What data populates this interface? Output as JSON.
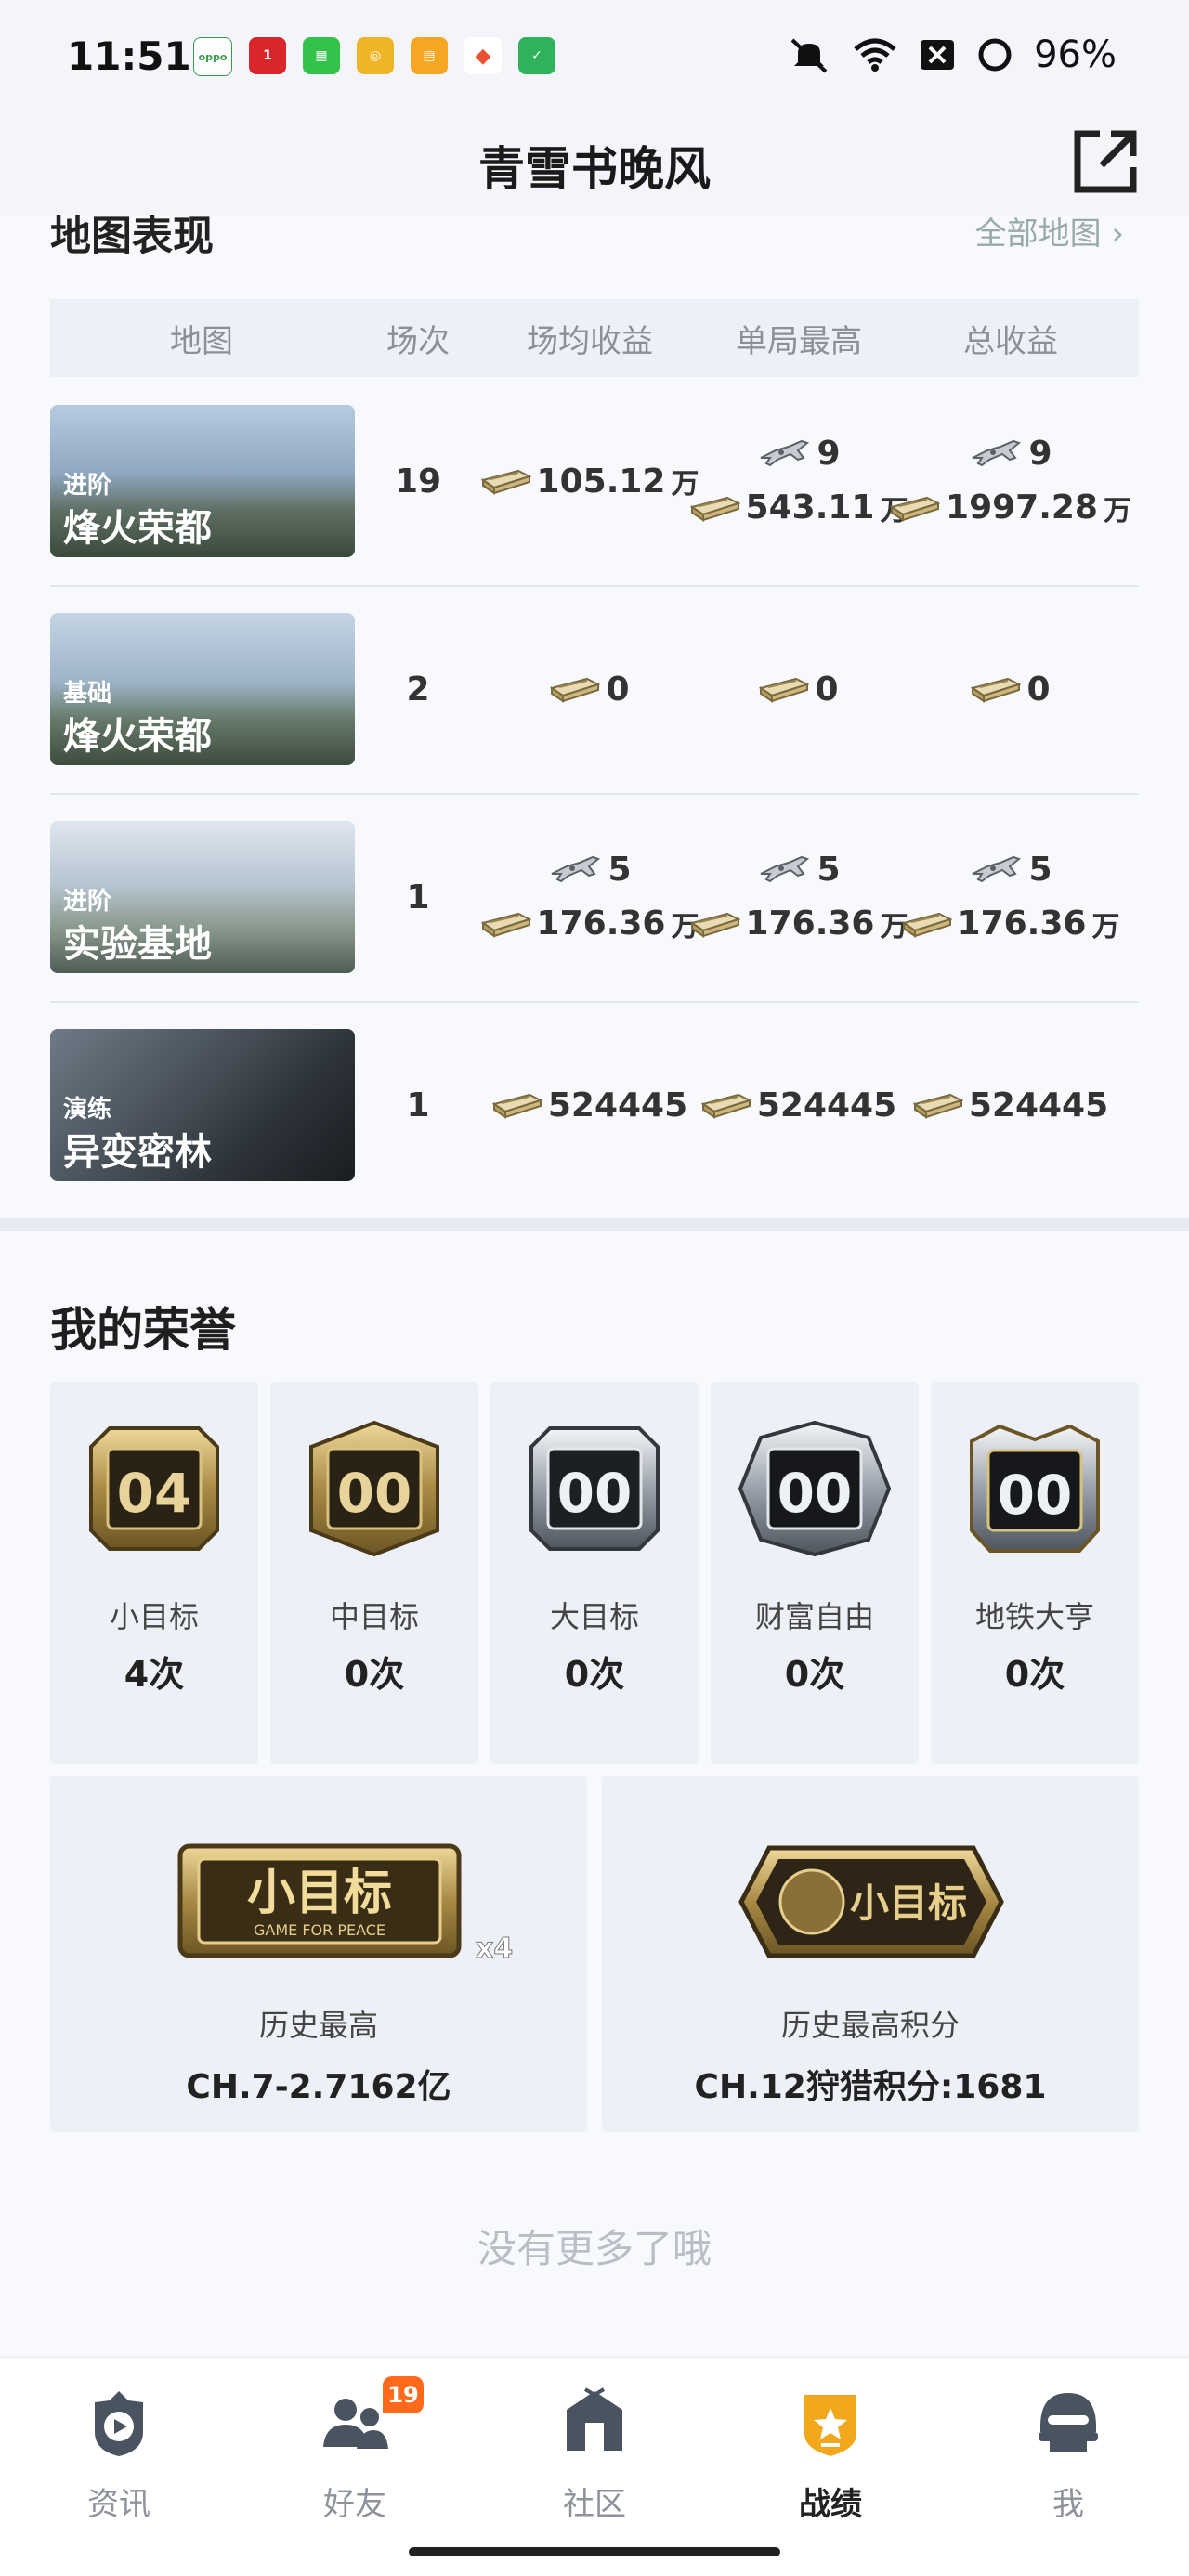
{
  "status_bar": {
    "time": "11:51",
    "battery": "96%"
  },
  "header": {
    "title": "青雪书晚风"
  },
  "maps_section": {
    "title": "地图表现",
    "all_maps": "全部地图 ›",
    "columns": [
      "地图",
      "场次",
      "场均收益",
      "单局最高",
      "总收益"
    ],
    "rows": [
      {
        "mode": "进阶",
        "name": "烽火荣都",
        "games": "19",
        "avg": {
          "cash": "105.12",
          "unit": "万"
        },
        "best": {
          "plane": "9",
          "cash": "543.11",
          "unit": "万"
        },
        "total": {
          "plane": "9",
          "cash": "1997.28",
          "unit": "万"
        }
      },
      {
        "mode": "基础",
        "name": "烽火荣都",
        "games": "2",
        "avg": {
          "cash": "0"
        },
        "best": {
          "cash": "0"
        },
        "total": {
          "cash": "0"
        }
      },
      {
        "mode": "进阶",
        "name": "实验基地",
        "games": "1",
        "avg": {
          "plane": "5",
          "cash": "176.36",
          "unit": "万"
        },
        "best": {
          "plane": "5",
          "cash": "176.36",
          "unit": "万"
        },
        "total": {
          "plane": "5",
          "cash": "176.36",
          "unit": "万"
        }
      },
      {
        "mode": "演练",
        "name": "异变密林",
        "games": "1",
        "avg": {
          "cash": "524445"
        },
        "best": {
          "cash": "524445"
        },
        "total": {
          "cash": "524445"
        }
      }
    ]
  },
  "honors": {
    "title": "我的荣誉",
    "badges": [
      {
        "number": "04",
        "label": "小目标",
        "count": "4次"
      },
      {
        "number": "00",
        "label": "中目标",
        "count": "0次"
      },
      {
        "number": "00",
        "label": "大目标",
        "count": "0次"
      },
      {
        "number": "00",
        "label": "财富自由",
        "count": "0次"
      },
      {
        "number": "00",
        "label": "地铁大亨",
        "count": "0次"
      }
    ],
    "history": [
      {
        "badge_text": "小目标",
        "badge_sub": "GAME FOR PEACE",
        "multiplier": "x4",
        "label": "历史最高",
        "value": "CH.7-2.7162亿"
      },
      {
        "badge_text": "小目标",
        "label": "历史最高积分",
        "value": "CH.12狩猎积分:1681"
      }
    ],
    "no_more": "没有更多了哦"
  },
  "bottom_nav": {
    "items": [
      {
        "label": "资讯",
        "icon": "news-icon"
      },
      {
        "label": "好友",
        "icon": "friends-icon",
        "badge": "19"
      },
      {
        "label": "社区",
        "icon": "community-icon"
      },
      {
        "label": "战绩",
        "icon": "record-icon",
        "active": true
      },
      {
        "label": "我",
        "icon": "profile-icon"
      }
    ]
  },
  "colors": {
    "accent": "#f2a81d",
    "badge_orange": "#ff6a1a",
    "muted_text": "#8d929b"
  }
}
